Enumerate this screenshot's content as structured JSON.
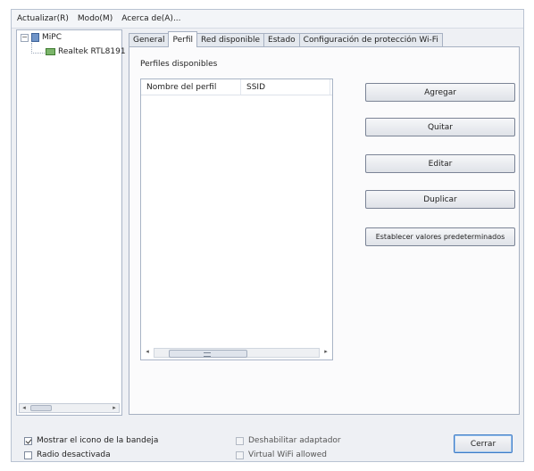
{
  "menu": [
    {
      "label": "Actualizar(R)"
    },
    {
      "label": "Modo(M)"
    },
    {
      "label": "Acerca de(A)..."
    }
  ],
  "tree": {
    "root_label": "MiPC",
    "root_expander": "−",
    "child_label": "Realtek RTL8191",
    "scroll_left": "◂",
    "scroll_right": "▸"
  },
  "tabs": [
    {
      "label": "General"
    },
    {
      "label": "Perfil"
    },
    {
      "label": "Red disponible"
    },
    {
      "label": "Estado"
    },
    {
      "label": "Configuración de protección Wi-Fi"
    }
  ],
  "active_tab": "Perfil",
  "profiles": {
    "group_label": "Perfiles disponibles",
    "columns": [
      "Nombre del perfil",
      "SSID"
    ],
    "rows": [],
    "scroll_left": "◂",
    "scroll_right": "▸"
  },
  "buttons": {
    "add": "Agregar",
    "remove": "Quitar",
    "edit": "Editar",
    "duplicate": "Duplicar",
    "set_default": "Establecer valores predeterminados"
  },
  "footer": {
    "show_tray_icon": {
      "label": "Mostrar el icono de la bandeja",
      "checked": true
    },
    "radio_off": {
      "label": "Radio desactivada",
      "checked": false
    },
    "disable_adapter": {
      "label": "Deshabilitar adaptador",
      "checked": false,
      "disabled": true
    },
    "virtual_wifi": {
      "label": "Virtual WiFi allowed",
      "checked": false,
      "disabled": true
    },
    "close_button": "Cerrar"
  }
}
